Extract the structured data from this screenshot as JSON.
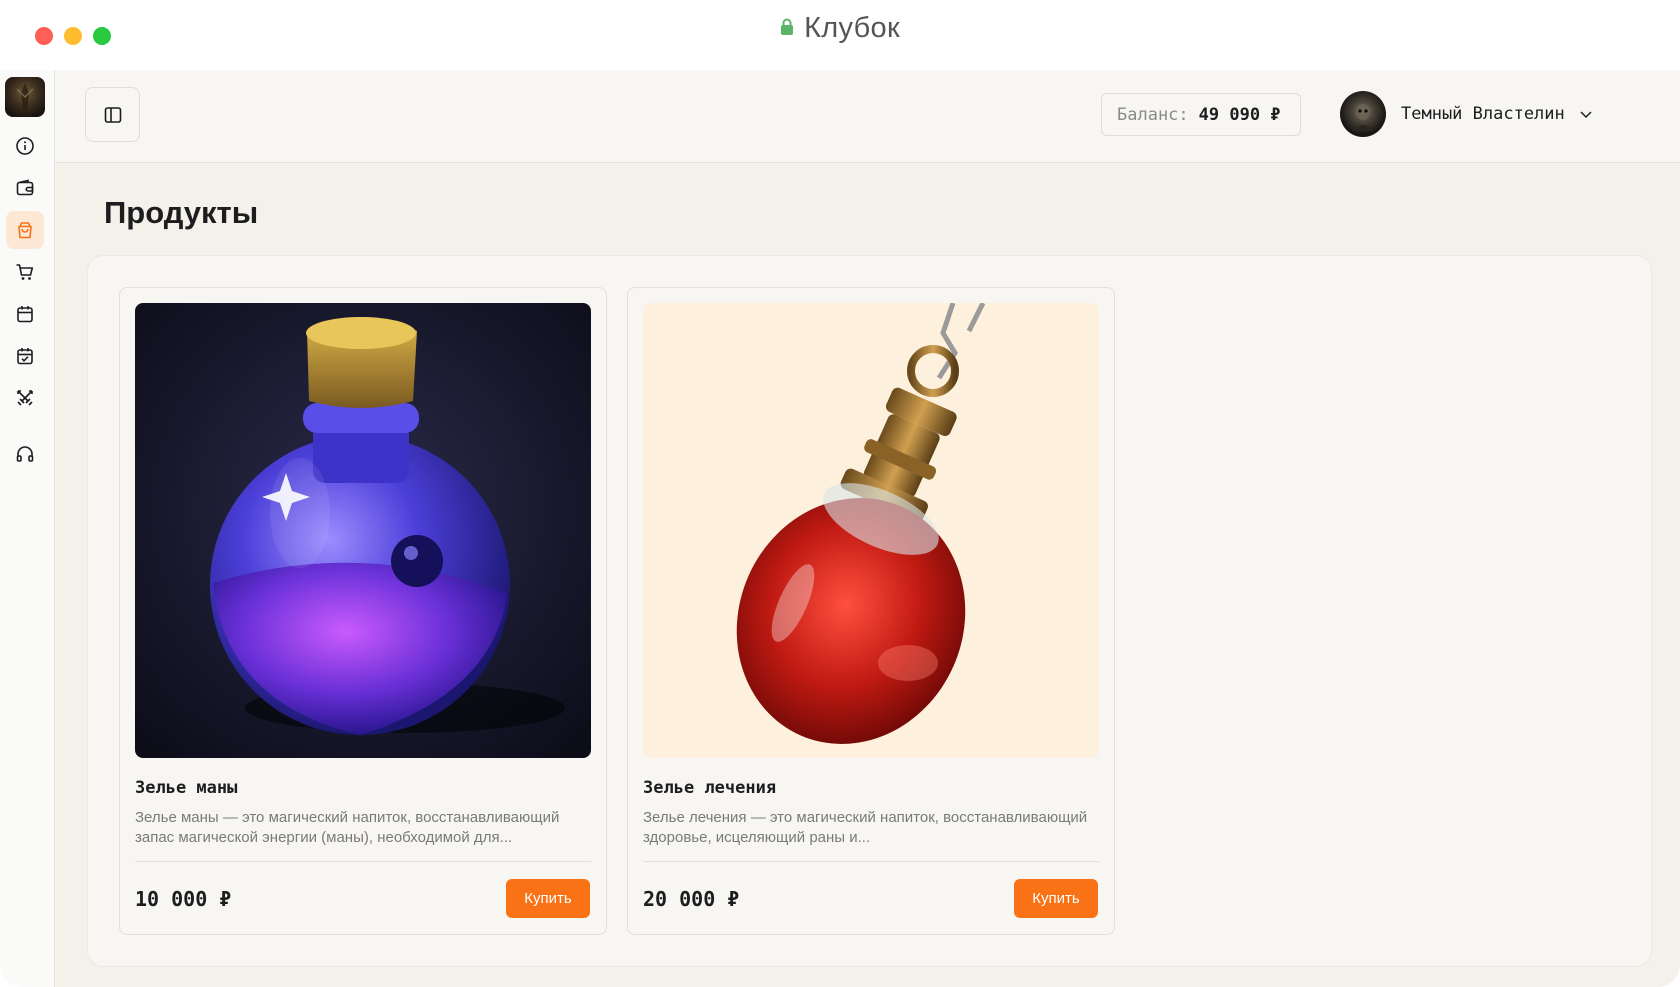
{
  "window": {
    "title": "Клубок"
  },
  "sidebar": {
    "logo": "app-logo",
    "items": [
      {
        "icon": "info-icon"
      },
      {
        "icon": "wallet-icon"
      },
      {
        "icon": "shopping-bag-icon",
        "active": true
      },
      {
        "icon": "cart-icon"
      },
      {
        "icon": "calendar-icon"
      },
      {
        "icon": "calendar-check-icon"
      },
      {
        "icon": "swords-icon"
      },
      {
        "icon": "headphones-icon"
      }
    ]
  },
  "header": {
    "toggle_icon": "sidebar-toggle-icon",
    "balance_label": "Баланс:",
    "balance_value": "49 090 ₽",
    "user_name": "Темный Властелин"
  },
  "main": {
    "page_title": "Продукты",
    "products": [
      {
        "name": "Зелье маны",
        "description": "Зелье маны — это магический напиток, восстанавливающий запас магической энергии (маны), необходимой для...",
        "price": "10 000 ₽",
        "buy_label": "Купить",
        "image": "mana-potion-image"
      },
      {
        "name": "Зелье лечения",
        "description": "Зелье лечения — это магический напиток, восстанавливающий здоровье, исцеляющий раны и...",
        "price": "20 000 ₽",
        "buy_label": "Купить",
        "image": "healing-potion-image"
      }
    ]
  },
  "colors": {
    "accent": "#f97316",
    "active_bg": "#fde8d6",
    "main_bg": "#f3f1ea"
  }
}
